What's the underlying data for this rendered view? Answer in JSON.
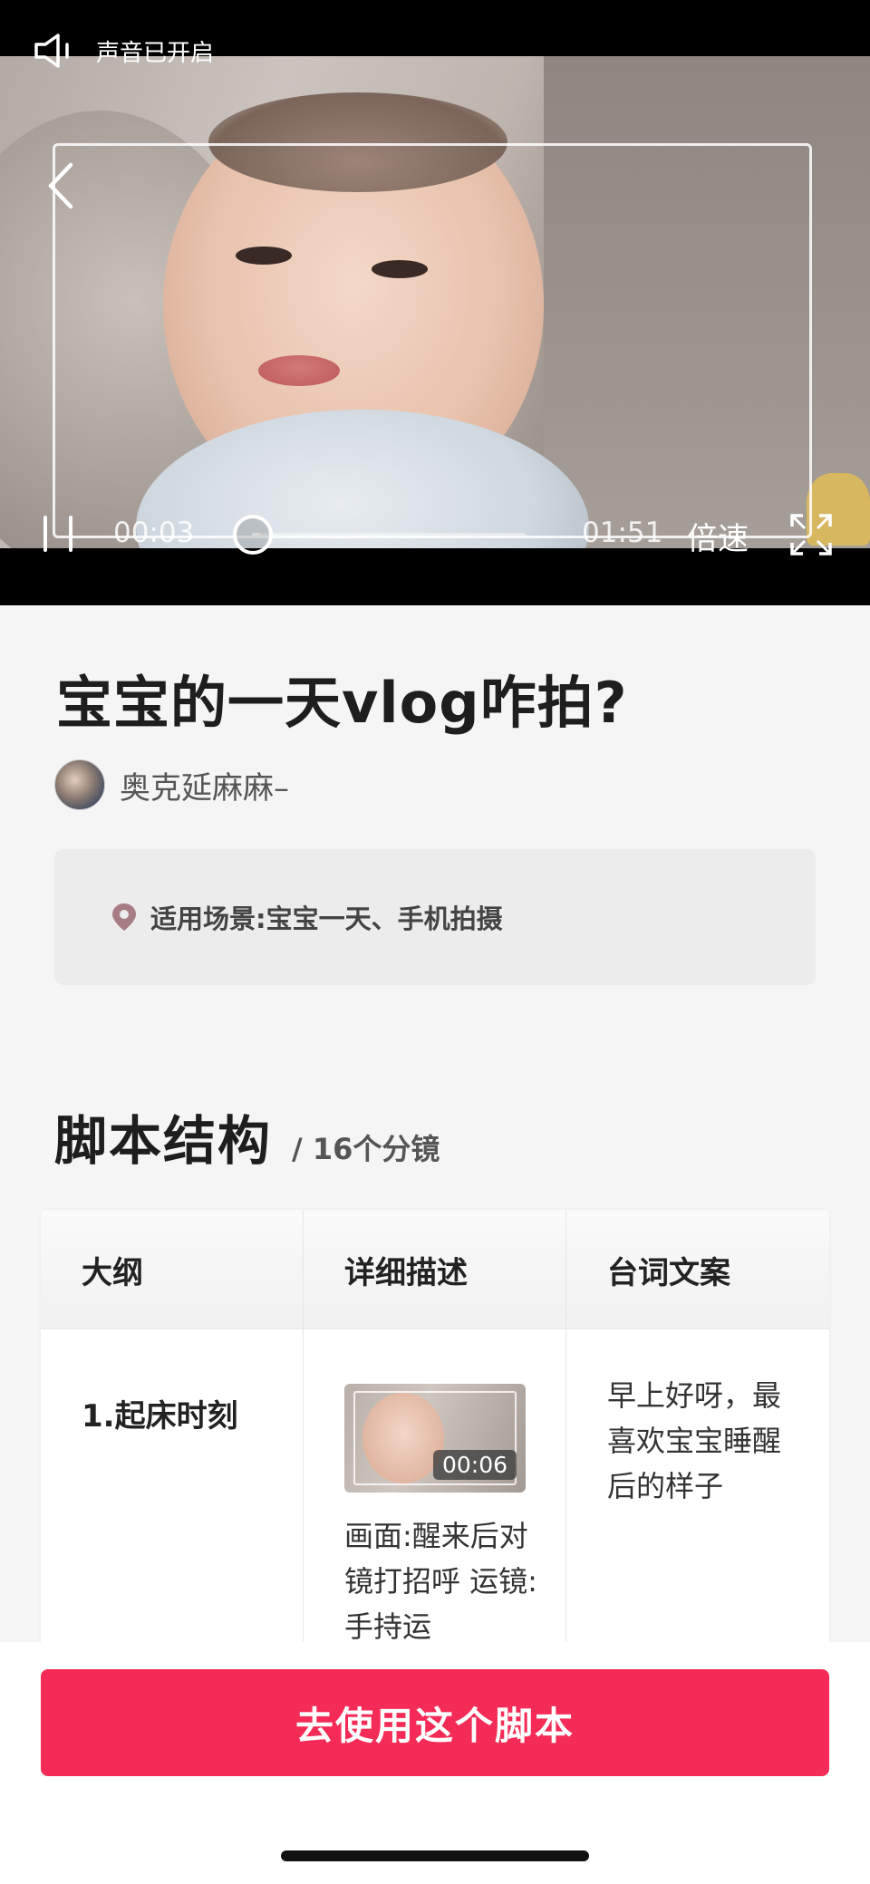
{
  "status": {
    "sound_label": "声音已开启"
  },
  "player": {
    "current_time": "00:03",
    "total_time": "01:51",
    "progress": 0.03,
    "speed_label": "倍速"
  },
  "template": {
    "title": "宝宝的一天vlog咋拍?",
    "author": "奥克延麻麻–",
    "scene": "适用场景:宝宝一天、手机拍摄"
  },
  "script_section": {
    "title": "脚本结构",
    "subtitle": "/ 16个分镜"
  },
  "table": {
    "headers": [
      "大纲",
      "详细描述",
      "台词文案"
    ],
    "rows": [
      {
        "outline": "1.起床时刻",
        "thumb_duration": "00:06",
        "description": "画面:醒来后对镜打招呼 运镜:手持运",
        "line": "早上好呀，最喜欢宝宝睡醒后的样子"
      }
    ]
  },
  "cta": {
    "label": "去使用这个脚本",
    "color": "#f42b56"
  }
}
